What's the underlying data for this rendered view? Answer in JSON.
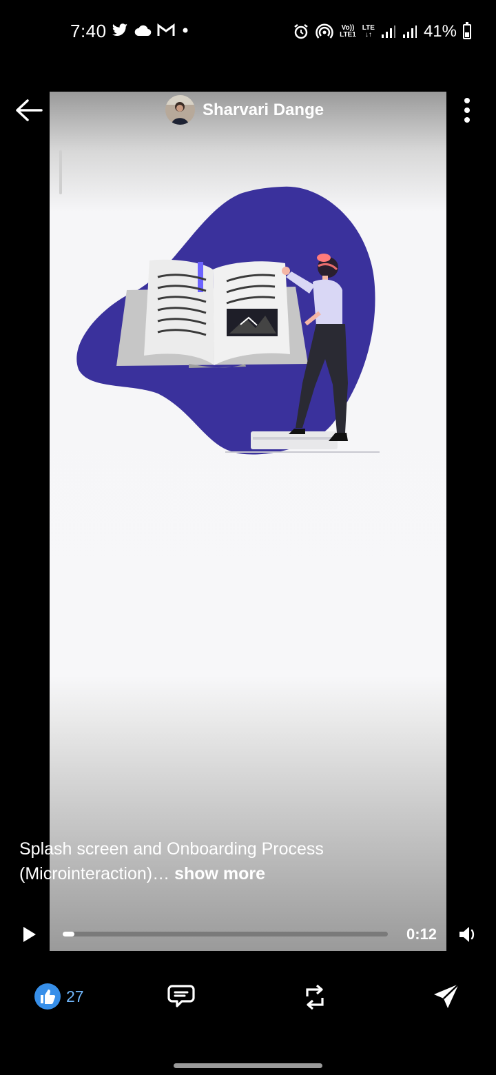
{
  "status_bar": {
    "time": "7:40",
    "network_top": "Vo))",
    "network_bottom": "LTE1",
    "lte_label": "LTE",
    "battery": "41%"
  },
  "post": {
    "author_name": "Sharvari Dange",
    "caption": "Splash screen and Onboarding Process (Microinteraction)…",
    "show_more": "show more"
  },
  "player": {
    "time": "0:12",
    "progress": 0.035
  },
  "actions": {
    "like_count": "27"
  },
  "colors": {
    "accent": "#378fe9",
    "illustration_blob": "#3a319c",
    "like_count": "#71b7fb"
  }
}
